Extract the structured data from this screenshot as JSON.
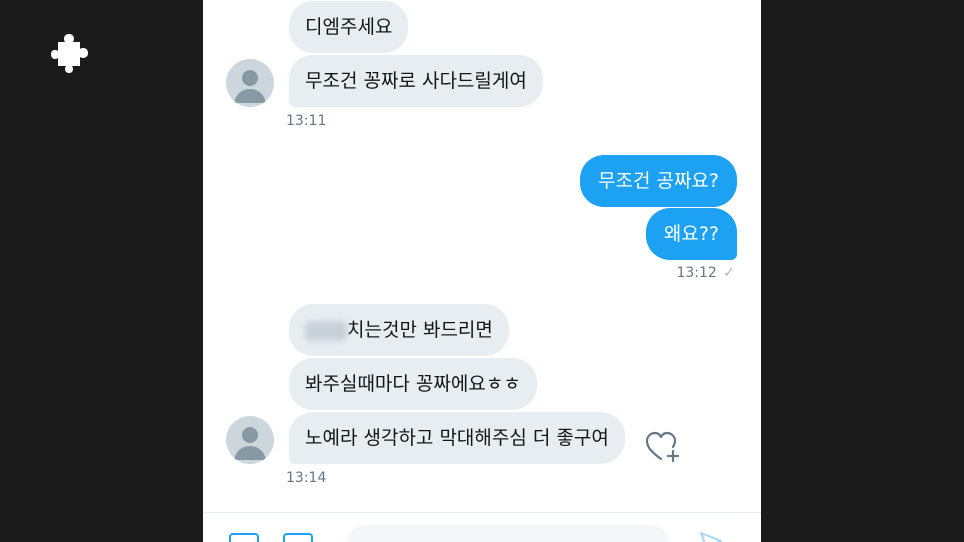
{
  "conversation": {
    "messages": [
      {
        "text": "디엠주세요"
      },
      {
        "text": "무조건 꽁짜로 사다드릴게여"
      },
      {
        "time": "13:11"
      },
      {
        "text": "무조건 공짜요?"
      },
      {
        "text": "왜요??"
      },
      {
        "time": "13:12",
        "status": "✓"
      },
      {
        "text": "치는것만 봐드리면"
      },
      {
        "text": "봐주실때마다 꽁짜에요ㅎㅎ"
      },
      {
        "text": "노예라 생각하고 막대해주심 더 좋구여"
      },
      {
        "time": "13:14"
      }
    ]
  },
  "icons": {
    "background": "puzzle-icon",
    "avatar": "default-avatar-icon",
    "like": "heart-plus-icon",
    "send": "send-icon"
  },
  "colors": {
    "accent": "#1da1f2",
    "incoming_bubble": "#e7edf1",
    "timestamp": "#657786"
  }
}
